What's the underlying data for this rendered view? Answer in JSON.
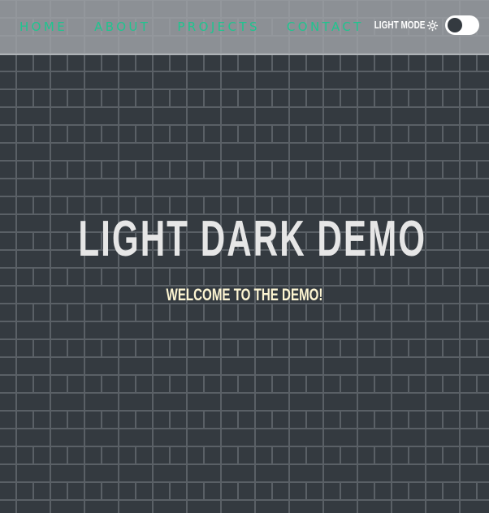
{
  "nav": {
    "links": [
      "HOME",
      "ABOUT",
      "PROJECTS",
      "CONTACT"
    ],
    "mode_label": "LIGHT MODE",
    "mode_icon": "gear-icon",
    "toggle_state": "off",
    "link_color": "#1fc58f"
  },
  "hero": {
    "title": "LIGHT DARK DEMO",
    "subtitle": "WELCOME TO THE DEMO!"
  },
  "colors": {
    "background": "#343a40",
    "brick_mortar": "#5a6066",
    "title": "#e6e6e6",
    "subtitle": "#fdf5d2"
  }
}
